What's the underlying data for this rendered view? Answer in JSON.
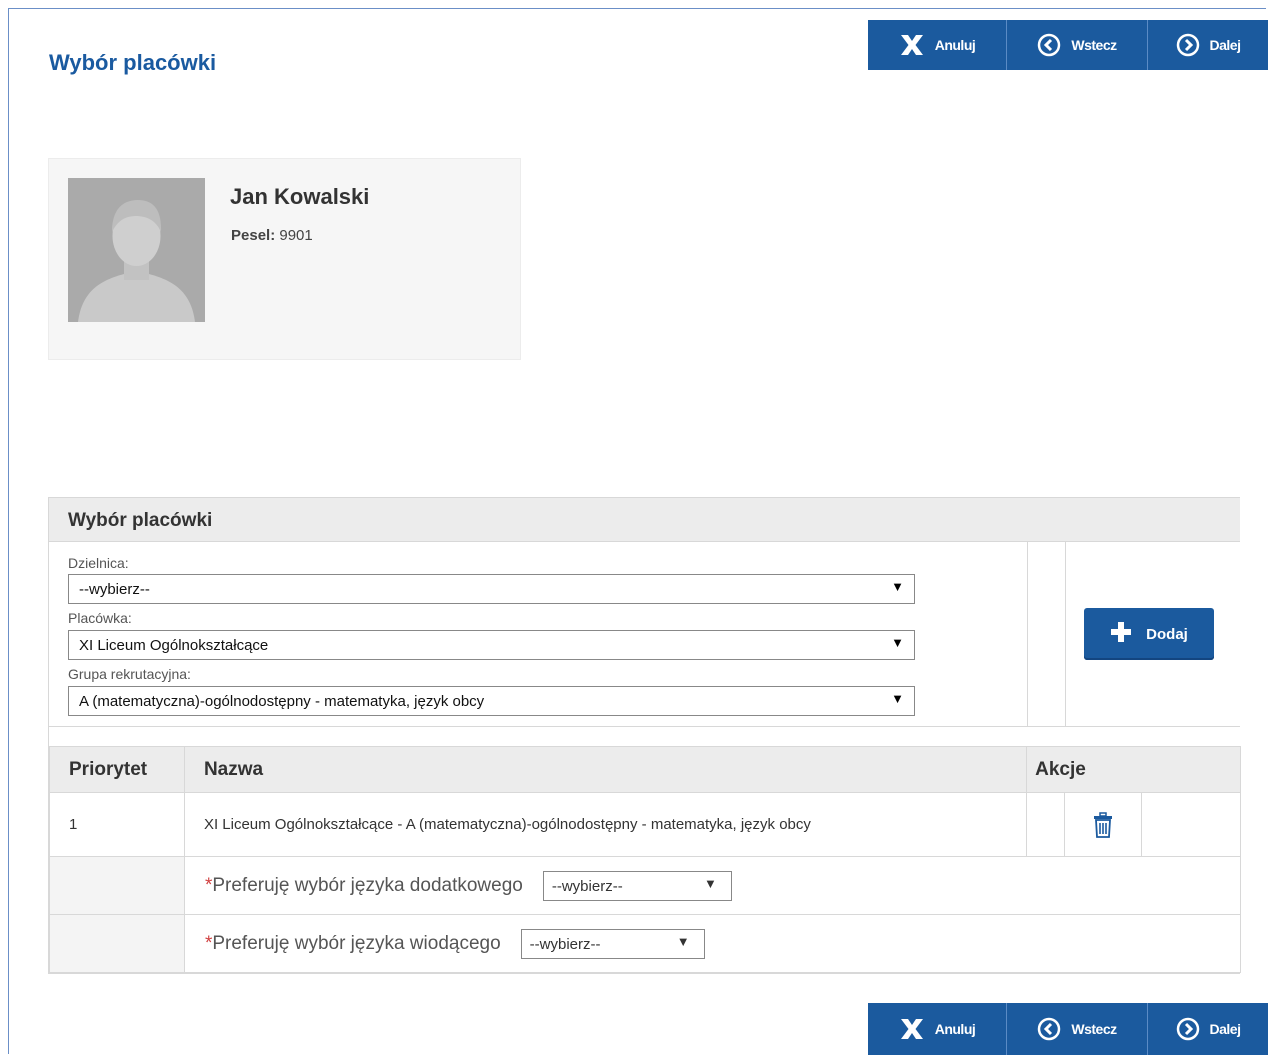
{
  "page": {
    "title": "Wybór placówki"
  },
  "nav": {
    "cancel_label": "Anuluj",
    "back_label": "Wstecz",
    "next_label": "Dalej"
  },
  "profile": {
    "name": "Jan Kowalski",
    "pesel_label": "Pesel:",
    "pesel_value": "9901"
  },
  "panel": {
    "title": "Wybór placówki",
    "district": {
      "label": "Dzielnica:",
      "value": "--wybierz--"
    },
    "school": {
      "label": "Placówka:",
      "value": "XI Liceum Ogólnokształcące"
    },
    "group": {
      "label": "Grupa rekrutacyjna:",
      "value": "A (matematyczna)-ogólnodostępny - matematyka, język obcy"
    },
    "add_label": "Dodaj"
  },
  "table": {
    "headers": [
      "Priorytet",
      "Nazwa",
      "Akcje"
    ],
    "rows": [
      {
        "priority": "1",
        "name": "XI Liceum Ogólnokształcące - A (matematyczna)-ogólnodostępny - matematyka, język obcy"
      }
    ],
    "preferences": [
      {
        "required_mark": "*",
        "label": "Preferuję wybór języka dodatkowego",
        "value": "--wybierz--"
      },
      {
        "required_mark": "*",
        "label": "Preferuję wybór języka wiodącego",
        "value": "--wybierz--"
      }
    ]
  },
  "colors": {
    "primary": "#1b5a9e",
    "title": "#1a5aa0",
    "required": "#d04040",
    "header_bg": "#ececec"
  },
  "icons": {
    "cancel": "x-icon",
    "back": "circle-arrow-left-icon",
    "next": "circle-arrow-right-icon",
    "add": "plus-icon",
    "delete": "trash-icon",
    "avatar": "user-silhouette-icon"
  }
}
